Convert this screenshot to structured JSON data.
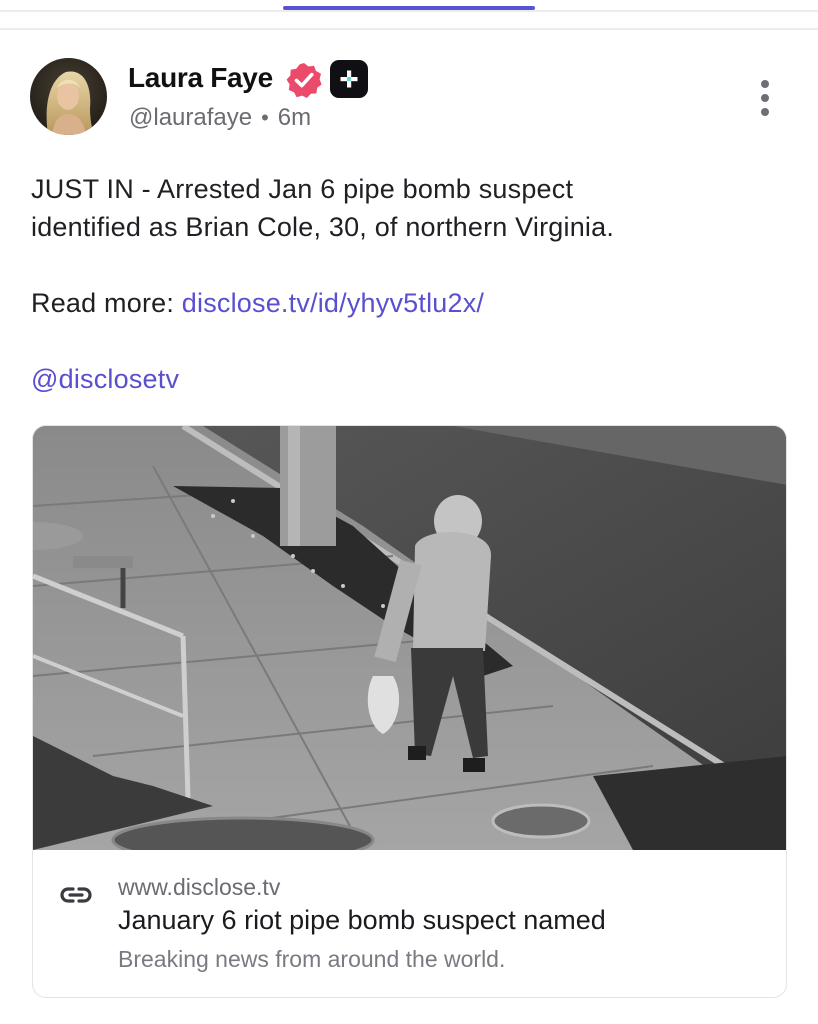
{
  "post": {
    "author": {
      "name": "Laura Faye",
      "handle": "@laurafaye",
      "time": "6m"
    },
    "text": {
      "line1": "JUST IN - Arrested Jan 6 pipe bomb suspect",
      "line2": "identified as Brian Cole, 30, of northern Virginia.",
      "read_more_label": "Read more: ",
      "read_more_link": "disclose.tv/id/yhyv5tlu2x/",
      "mention": "@disclosetv"
    },
    "link_card": {
      "domain": "www.disclose.tv",
      "title": "January 6 riot pipe bomb suspect named",
      "description": "Breaking news from around the world."
    }
  },
  "icons": {
    "verified": "verified-badge-icon",
    "plus": "plus-badge-icon",
    "more": "more-vertical-icon",
    "link": "link-icon"
  },
  "colors": {
    "accent": "#5a52d5",
    "link": "#5a4fcf",
    "verified": "#ec4a6a",
    "muted_text": "#6b6b73"
  }
}
